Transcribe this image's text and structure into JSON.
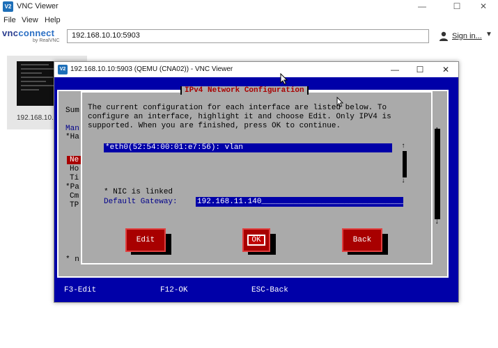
{
  "app": {
    "title": "VNC Viewer",
    "logo": "V2",
    "menu": [
      "File",
      "View",
      "Help"
    ],
    "brand": {
      "name_a": "vnc",
      "name_b": "connect",
      "byline": "by RealVNC"
    },
    "address_value": "192.168.10.10:5903",
    "signin_label": "Sign in...",
    "window_controls": {
      "minimize": "—",
      "maximize": "☐",
      "close": "✕"
    }
  },
  "thumbnail": {
    "label": "192.168.10.10..."
  },
  "viewer": {
    "title": "192.168.10.10:5903 (QEMU (CNA02)) - VNC Viewer",
    "controls": {
      "minimize": "—",
      "maximize": "☐",
      "close": "✕"
    }
  },
  "console": {
    "background": {
      "sum": "Sum",
      "man": "Man",
      "items": [
        "*Ha",
        "Ne",
        "Ho",
        "Ti",
        "*Pa",
        "Cm",
        "TP"
      ],
      "footer_note": "* n",
      "scroll_up": "↑",
      "scroll_down": "↓"
    },
    "dialog": {
      "title": "IPv4 Network Configuration",
      "info_lines": [
        "The current configuration for each interface are listed below. To",
        "configure an interface, highlight it and choose Edit. Only IPV4 is",
        "supported. When you are finished, press OK to continue."
      ],
      "interfaces": [
        "*eth0(52:54:00:01:e7:56): vlan"
      ],
      "nic_status": "* NIC is linked",
      "gateway_label": "Default Gateway:",
      "gateway_value": "192.168.11.140",
      "scroll_up": "↑",
      "scroll_down": "↓",
      "buttons": {
        "edit": "Edit",
        "ok": "OK",
        "back": "Back"
      }
    },
    "function_keys": [
      "F3-Edit",
      "F12-OK",
      "ESC-Back"
    ]
  },
  "colors": {
    "console_blue": "#0000a8",
    "console_grey": "#aaaaaa",
    "console_red": "#a80000",
    "vnc_brand": "#2a6fc4"
  }
}
